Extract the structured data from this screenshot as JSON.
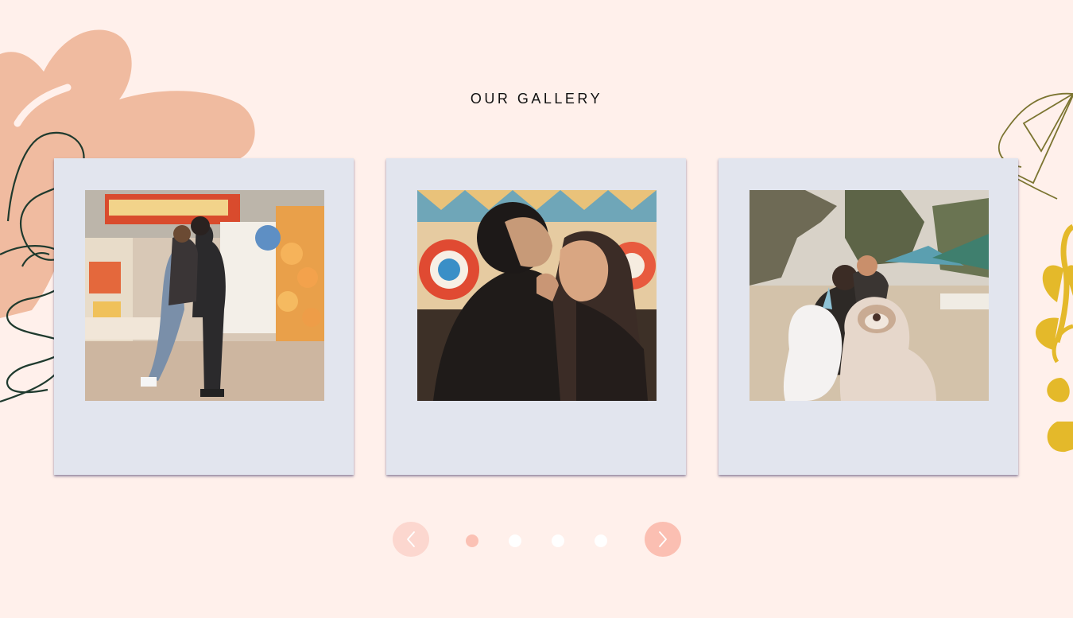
{
  "gallery": {
    "title": "OUR GALLERY",
    "photos": [
      {
        "description_icon": "photo-couple-carnival"
      },
      {
        "description_icon": "photo-couple-closeup"
      },
      {
        "description_icon": "photo-couple-plush-toys"
      }
    ],
    "carousel": {
      "prev_icon": "chevron-left-icon",
      "next_icon": "chevron-right-icon",
      "dot_count": 4,
      "active_index": 0
    }
  },
  "colors": {
    "background": "#fff0eb",
    "card": "#e2e5ee",
    "accent_peach": "#f0bba0",
    "accent_coral": "#fbbfb2",
    "accent_yellow": "#e4b92a",
    "line_dark_green": "#1f3a2e",
    "line_olive": "#7b7430"
  }
}
